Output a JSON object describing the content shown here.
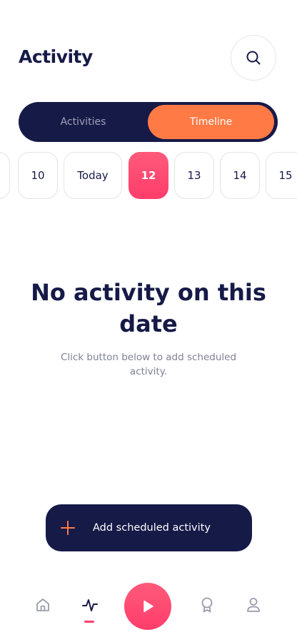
{
  "header": {
    "title": "Activity"
  },
  "icons": {
    "search": "search-icon",
    "plus": "plus-icon",
    "home": "home-icon",
    "activity": "activity-pulse-icon",
    "play": "play-icon",
    "award": "award-icon",
    "profile": "profile-icon"
  },
  "segmented": {
    "tabs": [
      {
        "label": "Activities",
        "selected": false
      },
      {
        "label": "Timeline",
        "selected": true
      }
    ]
  },
  "dates": {
    "items": [
      {
        "label": "",
        "selected": false
      },
      {
        "label": "10",
        "selected": false
      },
      {
        "label": "Today",
        "selected": false
      },
      {
        "label": "12",
        "selected": true
      },
      {
        "label": "13",
        "selected": false
      },
      {
        "label": "14",
        "selected": false
      },
      {
        "label": "15",
        "selected": false
      }
    ]
  },
  "empty_state": {
    "title": "No activity on this date",
    "subtitle": "Click button below to add scheduled activity."
  },
  "add_button": {
    "label": "Add scheduled activity"
  },
  "colors": {
    "navy": "#161a47",
    "orange": "#ff7a45",
    "pink": "#ff3d6b",
    "muted": "#7d8096"
  },
  "tabbar": {
    "active": "activity"
  }
}
